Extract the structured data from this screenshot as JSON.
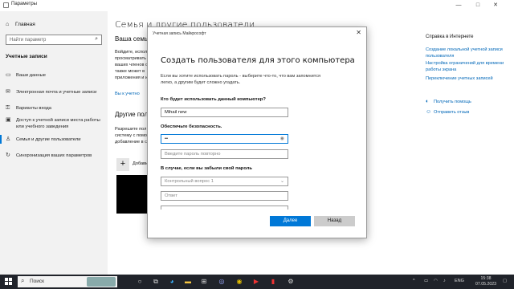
{
  "window": {
    "title": "Параметры",
    "controls": {
      "minimize": "—",
      "maximize": "□",
      "close": "✕"
    }
  },
  "sidebar": {
    "home": "Главная",
    "search_placeholder": "Найти параметр",
    "section_title": "Учетные записи",
    "items": [
      {
        "icon": "person-card-icon",
        "label": "Ваши данные"
      },
      {
        "icon": "mail-icon",
        "label": "Электронная почта и учетные записи"
      },
      {
        "icon": "key-icon",
        "label": "Варианты входа"
      },
      {
        "icon": "briefcase-icon",
        "label": "Доступ к учетной записи места работы или учебного заведения"
      },
      {
        "icon": "people-icon",
        "label": "Семья и другие пользователи"
      },
      {
        "icon": "sync-icon",
        "label": "Синхронизация ваших параметров"
      }
    ]
  },
  "main": {
    "title": "Семья и другие пользователи",
    "family_heading": "Ваша семья",
    "family_text": [
      "Войдите, исполь",
      "просматривать с",
      "ваших членов с",
      "также может в",
      "приложения и и"
    ],
    "family_link": "Вы к учетно",
    "others_heading": "Другие пол",
    "others_text": [
      "Разрешите пол",
      "систему с помо",
      "добавление в с"
    ],
    "add_label": "Добави"
  },
  "right": {
    "title": "Справка в Интернете",
    "links": [
      "Создание локальной учетной записи пользователя",
      "Настройка ограничений для времени работы экрана",
      "Переключение учетных записей"
    ],
    "help": "Получить помощь",
    "feedback": "Отправить отзыв"
  },
  "dialog": {
    "caption": "Учетная запись Майкрософт",
    "title": "Создать пользователя для этого компьютера",
    "desc": "Если вы хотите использовать пароль - выберите что-то, что вам запомнится легко, а другим будет сложно угадать.",
    "who_label": "Кто будет использовать данный компьютер?",
    "username": "Mihail new",
    "security_label": "Обеспечьте безопасность.",
    "password": "••",
    "confirm_placeholder": "Введите пароль повторно",
    "forgot_label": "В случае, если вы забыли свой пароль",
    "question1": "Контрольный вопрос 1",
    "answer_placeholder": "Ответ",
    "next": "Далее",
    "back": "Назад"
  },
  "taskbar": {
    "search": "Поиск",
    "lang": "ENG",
    "time": "15:38",
    "date": "07.05.2023"
  }
}
